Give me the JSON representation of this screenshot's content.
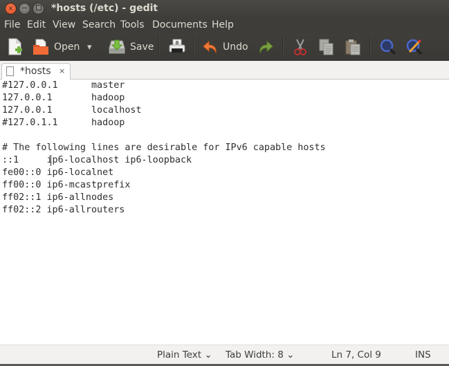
{
  "window": {
    "title": "*hosts (/etc) - gedit",
    "controls": {
      "close": "×",
      "minimize": "—",
      "maximize": "□"
    }
  },
  "menubar": {
    "items": [
      "File",
      "Edit",
      "View",
      "Search",
      "Tools",
      "Documents",
      "Help"
    ]
  },
  "toolbar": {
    "new_icon": "new-document-icon",
    "open_label": "Open",
    "open_dropdown": "▾",
    "save_label": "Save",
    "print_icon": "print-icon",
    "undo_label": "Undo",
    "redo_icon": "redo-icon",
    "cut_icon": "cut-icon",
    "copy_icon": "copy-icon",
    "paste_icon": "paste-icon",
    "find_icon": "search-icon",
    "replace_icon": "find-replace-icon"
  },
  "tabs": [
    {
      "label": "*hosts",
      "close": "×",
      "active": true
    }
  ],
  "editor": {
    "lines": [
      "#127.0.0.1      master",
      "127.0.0.1       hadoop",
      "127.0.0.1       localhost",
      "#127.0.1.1      hadoop",
      "",
      "# The following lines are desirable for IPv6 capable hosts",
      "::1     ip6-localhost ip6-loopback",
      "fe00::0 ip6-localnet",
      "ff00::0 ip6-mcastprefix",
      "ff02::1 ip6-allnodes",
      "ff02::2 ip6-allrouters"
    ],
    "cursor": {
      "line": 7,
      "col": 9
    }
  },
  "statusbar": {
    "language": "Plain Text",
    "tab_width": "Tab Width: 8",
    "dropdown_glyph": "⌄",
    "position": "Ln 7, Col 9",
    "mode": "INS"
  },
  "colors": {
    "titlebar": "#3e3d39",
    "close_button": "#df4b1c",
    "editor_bg": "#ffffff",
    "statusbar_bg": "#f2f1f0"
  }
}
